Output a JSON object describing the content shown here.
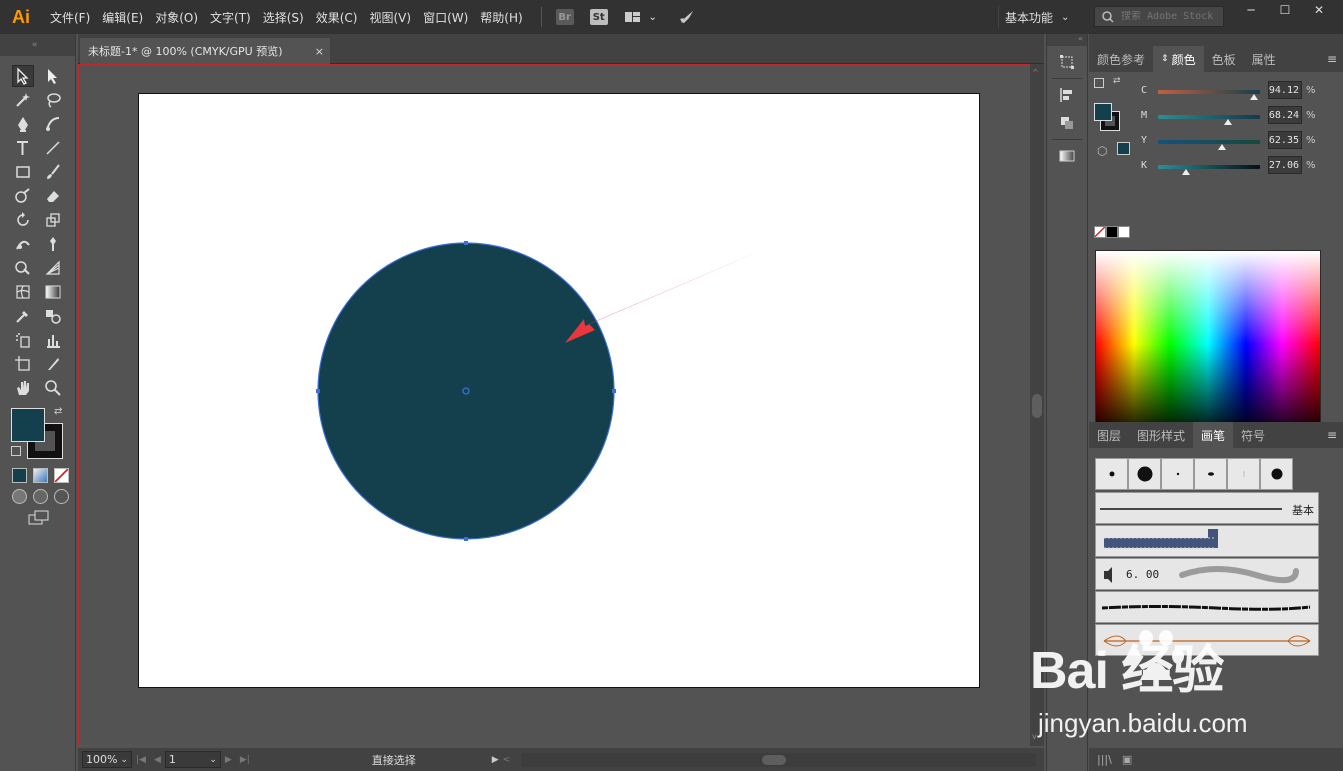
{
  "app": {
    "logo": "Ai",
    "menus": [
      "文件(F)",
      "编辑(E)",
      "对象(O)",
      "文字(T)",
      "选择(S)",
      "效果(C)",
      "视图(V)",
      "窗口(W)",
      "帮助(H)"
    ],
    "bridge_label": "Br",
    "stock_label": "St",
    "workspace": "基本功能",
    "search_placeholder": "搜索 Adobe Stock",
    "win_min": "─",
    "win_max": "☐",
    "win_close": "✕"
  },
  "document": {
    "tab_title": "未标题-1* @ 100% (CMYK/GPU 预览)",
    "tab_close": "×",
    "fill_color": "#143f4c",
    "stroke_color": "#000000",
    "selection_color": "#3a6fd8",
    "arrow_color": "#e8383d"
  },
  "status": {
    "zoom": "100%",
    "page": "1",
    "tool_name": "直接选择"
  },
  "color_panel": {
    "tabs": [
      "颜色参考",
      "颜色",
      "色板",
      "属性"
    ],
    "active_tab": 1,
    "sliders": [
      {
        "label": "C",
        "value": "94.12",
        "fraction": 0.9412,
        "from": "#c1603e",
        "to": "#143f4c"
      },
      {
        "label": "M",
        "value": "68.24",
        "fraction": 0.6824,
        "from": "#2a8f8f",
        "to": "#14384c"
      },
      {
        "label": "Y",
        "value": "62.35",
        "fraction": 0.6235,
        "from": "#15527f",
        "to": "#154a3a"
      },
      {
        "label": "K",
        "value": "27.06",
        "fraction": 0.2706,
        "from": "#2a8f9a",
        "to": "#050f12"
      }
    ],
    "unit": "%"
  },
  "brush_panel": {
    "tabs": [
      "图层",
      "图形样式",
      "画笔",
      "符号"
    ],
    "active_tab": 2,
    "basic_label": "基本",
    "size_label": "6. 00"
  },
  "watermark": {
    "word": "Bai  经验",
    "url": "jingyan.baidu.com"
  }
}
